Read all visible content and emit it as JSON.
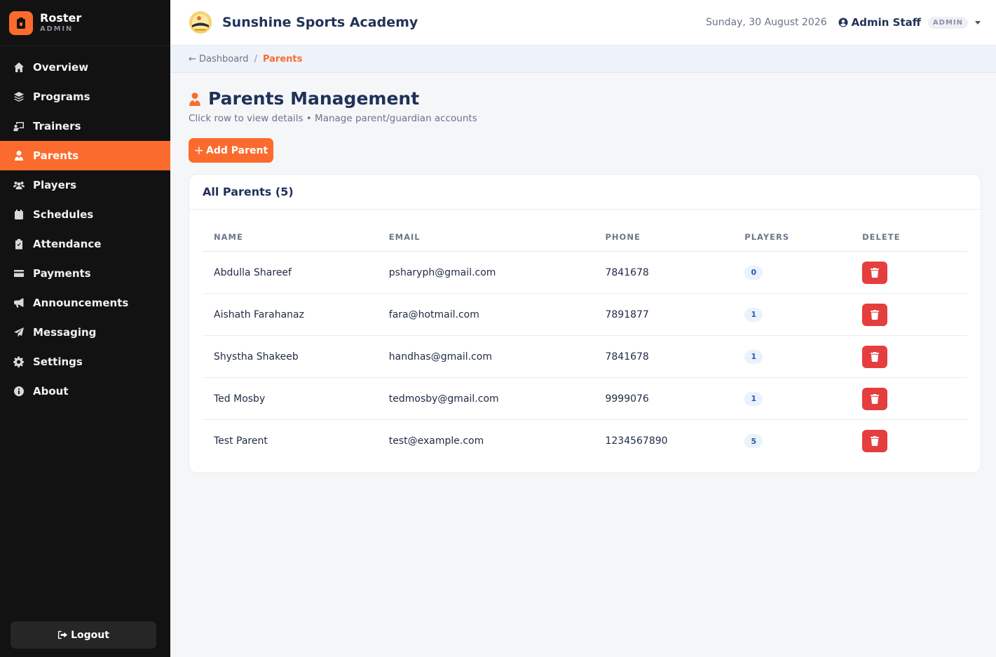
{
  "brand": {
    "title": "Roster",
    "subtitle": "ADMIN"
  },
  "sidebar": {
    "items": [
      {
        "label": "Overview",
        "icon": "home-icon",
        "active": false
      },
      {
        "label": "Programs",
        "icon": "layers-icon",
        "active": false
      },
      {
        "label": "Trainers",
        "icon": "chalkboard-teacher-icon",
        "active": false
      },
      {
        "label": "Parents",
        "icon": "user-tie-icon",
        "active": true
      },
      {
        "label": "Players",
        "icon": "users-icon",
        "active": false
      },
      {
        "label": "Schedules",
        "icon": "calendar-icon",
        "active": false
      },
      {
        "label": "Attendance",
        "icon": "clipboard-check-icon",
        "active": false
      },
      {
        "label": "Payments",
        "icon": "credit-card-icon",
        "active": false
      },
      {
        "label": "Announcements",
        "icon": "bullhorn-icon",
        "active": false
      },
      {
        "label": "Messaging",
        "icon": "paper-plane-icon",
        "active": false
      },
      {
        "label": "Settings",
        "icon": "gear-icon",
        "active": false
      },
      {
        "label": "About",
        "icon": "info-circle-icon",
        "active": false
      }
    ],
    "logout_label": "Logout"
  },
  "header": {
    "academy_name": "Sunshine Sports Academy",
    "date": "Sunday, 30 August 2026",
    "user_name": "Admin Staff",
    "role": "ADMIN"
  },
  "breadcrumb": {
    "back_label": "← Dashboard",
    "separator": "/",
    "current": "Parents"
  },
  "main": {
    "title": "Parents Management",
    "subtitle": "Click row to view details • Manage parent/guardian accounts",
    "add_button_label": "Add Parent",
    "card_title": "All Parents (5)",
    "columns": [
      "NAME",
      "EMAIL",
      "PHONE",
      "PLAYERS",
      "DELETE"
    ],
    "rows": [
      {
        "name": "Abdulla Shareef",
        "email": "psharyph@gmail.com",
        "phone": "7841678",
        "players": "0"
      },
      {
        "name": "Aishath Farahanaz",
        "email": "fara@hotmail.com",
        "phone": "7891877",
        "players": "1"
      },
      {
        "name": "Shystha Shakeeb",
        "email": "handhas@gmail.com",
        "phone": "7841678",
        "players": "1"
      },
      {
        "name": "Ted Mosby",
        "email": "tedmosby@gmail.com",
        "phone": "9999076",
        "players": "1"
      },
      {
        "name": "Test Parent",
        "email": "test@example.com",
        "phone": "1234567890",
        "players": "5"
      }
    ]
  },
  "colors": {
    "accent": "#fb6b2d",
    "sidebar_bg": "#121212",
    "danger": "#e53e3e",
    "heading": "#1f3158"
  }
}
